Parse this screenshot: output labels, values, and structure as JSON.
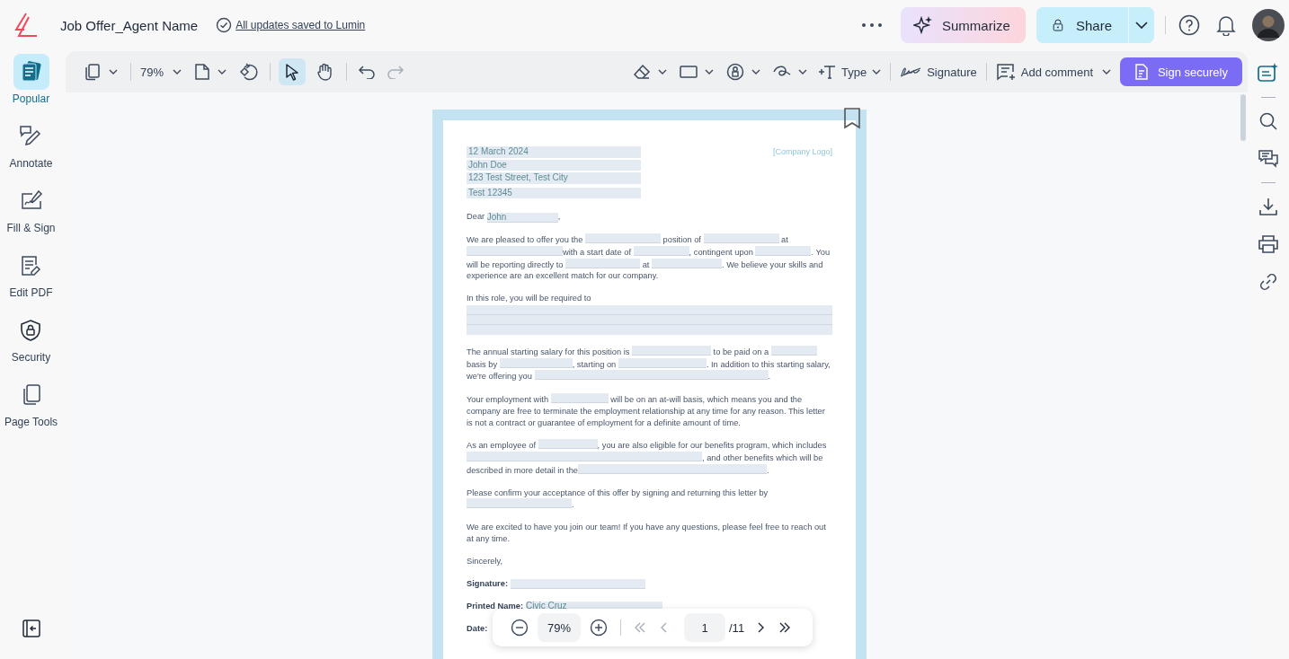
{
  "header": {
    "title": "Job Offer_Agent Name",
    "save_status": "All updates saved to Lumin",
    "summarize": "Summarize",
    "share": "Share"
  },
  "sidebar": {
    "items": [
      {
        "label": "Popular",
        "selected": true
      },
      {
        "label": "Annotate",
        "selected": false
      },
      {
        "label": "Fill & Sign",
        "selected": false
      },
      {
        "label": "Edit PDF",
        "selected": false
      },
      {
        "label": "Security",
        "selected": false
      },
      {
        "label": "Page Tools",
        "selected": false
      }
    ]
  },
  "toolbar": {
    "zoom": "79%",
    "tools": [
      {
        "kind": "select",
        "selected": true
      },
      {
        "kind": "hand",
        "selected": false
      }
    ],
    "type_label": "Type",
    "signature_label": "Signature",
    "comment_label": "Add comment",
    "sign_button": "Sign securely"
  },
  "document": {
    "company_logo": "[Company Logo]",
    "address": [
      "12 March 2024",
      "John Doe",
      "123 Test Street, Test City",
      "Test 12345"
    ],
    "paragraphs": [
      [
        {
          "kind": "text",
          "text": "Dear "
        },
        {
          "kind": "filled",
          "text": "John"
        },
        {
          "kind": "text",
          "text": ","
        }
      ],
      [
        {
          "kind": "text",
          "text": "We are pleased to offer you the "
        },
        {
          "kind": "blank"
        },
        {
          "kind": "text",
          "text": " position of "
        },
        {
          "kind": "blank"
        },
        {
          "kind": "text",
          "text": " at "
        },
        {
          "kind": "blank"
        },
        {
          "kind": "text",
          "text": "with a start date of "
        },
        {
          "kind": "blank"
        },
        {
          "kind": "text",
          "text": ", contingent upon "
        },
        {
          "kind": "blank"
        },
        {
          "kind": "text",
          "text": ". You will be reporting directly to "
        },
        {
          "kind": "blank"
        },
        {
          "kind": "text",
          "text": " at "
        },
        {
          "kind": "blank"
        },
        {
          "kind": "text",
          "text": ". We believe your skills and experience are an excellent match for our company."
        }
      ],
      [
        {
          "kind": "text",
          "text": "In this role, you will be required to"
        },
        {
          "kind": "area"
        }
      ],
      [
        {
          "kind": "text",
          "text": "The annual starting salary for this position is "
        },
        {
          "kind": "blank"
        },
        {
          "kind": "text",
          "text": " to be paid on a "
        },
        {
          "kind": "blank"
        },
        {
          "kind": "text",
          "text": " basis by "
        },
        {
          "kind": "blank"
        },
        {
          "kind": "text",
          "text": ", starting on "
        },
        {
          "kind": "blank"
        },
        {
          "kind": "text",
          "text": ". In addition to this starting salary, we're offering you "
        },
        {
          "kind": "blank"
        },
        {
          "kind": "text",
          "text": "."
        }
      ],
      [
        {
          "kind": "text",
          "text": "Your employment with "
        },
        {
          "kind": "blank"
        },
        {
          "kind": "text",
          "text": " will be on an at-will basis, which means you and the company are free to terminate the employment relationship at any time for any reason. This letter is not a contract or guarantee of employment for a definite amount of time."
        }
      ],
      [
        {
          "kind": "text",
          "text": "As an employee of "
        },
        {
          "kind": "blank"
        },
        {
          "kind": "text",
          "text": ", you are also eligible for our benefits program, which includes "
        },
        {
          "kind": "blank"
        },
        {
          "kind": "text",
          "text": ", and other benefits which will be described in more detail in the"
        },
        {
          "kind": "blank"
        },
        {
          "kind": "text",
          "text": "."
        }
      ],
      [
        {
          "kind": "text",
          "text": "Please confirm your acceptance of this offer by signing and returning this letter by "
        },
        {
          "kind": "blank"
        },
        {
          "kind": "text",
          "text": "."
        }
      ],
      [
        {
          "kind": "text",
          "text": "We are excited to have you join our team! If you have any questions, please feel free to reach out at any time."
        }
      ],
      [
        {
          "kind": "text",
          "text": "Sincerely,"
        }
      ]
    ],
    "fields": [
      {
        "label": "Signature:",
        "kind": "line"
      },
      {
        "label": "Printed Name:",
        "kind": "line",
        "value": "Civic Cruz"
      },
      {
        "label": "Date:",
        "kind": "covered"
      }
    ]
  },
  "page_nav": {
    "zoom": "79%",
    "page": "1",
    "total": "/11"
  }
}
